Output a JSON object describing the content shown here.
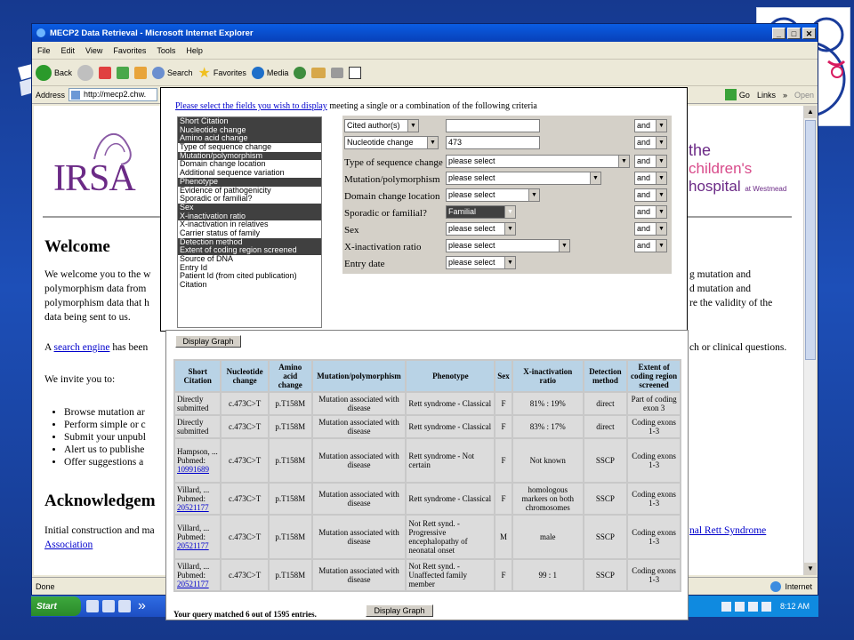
{
  "window": {
    "title": "MECP2 Data Retrieval - Microsoft Internet Explorer",
    "controls": [
      "_",
      "□",
      "✕"
    ],
    "menu": [
      "File",
      "Edit",
      "View",
      "Favorites",
      "Tools",
      "Help"
    ],
    "toolbar": {
      "back": "Back",
      "search": "Search",
      "favorites": "Favorites",
      "media": "Media"
    },
    "address_label": "Address",
    "address_value": "http://mecp2.chw.",
    "go": "Go",
    "links": "Links",
    "open": "Open",
    "status": "Done",
    "zone": "Internet"
  },
  "page": {
    "irsa": "IRSA",
    "chw": {
      "line1": "the",
      "line2": "children's",
      "line3": "hospital",
      "line3_small": "at Westmead"
    },
    "welcome_heading": "Welcome",
    "welcome_para_left": "We welcome you to the w",
    "welcome_para_left2": "polymorphism data from",
    "welcome_para_left3": "polymorphism data that h",
    "welcome_para_left4": "data being sent to us.",
    "welcome_para_right1": "g mutation and",
    "welcome_para_right2": "d mutation and",
    "welcome_para_right3": "re the validity of the",
    "search_prefix": "A ",
    "search_link": "search engine",
    "search_suffix": " has been",
    "search_right": "ch or clinical questions.",
    "invite": "We invite you to:",
    "bullets": [
      "Browse mutation ar",
      "Perform simple or c",
      "Submit your unpubl",
      "Alert us to publishe",
      "Offer suggestions a"
    ],
    "ack_heading": "Acknowledgem",
    "ack_text": "Initial construction and ma",
    "ack_link": "nal Rett Syndrome",
    "ack_link2": "Association"
  },
  "search": {
    "header_link": "Please select the fields you wish to display",
    "header_rest": " meeting a single or a combination of the following criteria",
    "fields": [
      {
        "label": "Short Citation",
        "selected": true
      },
      {
        "label": "Nucleotide change",
        "selected": true
      },
      {
        "label": "Amino acid change",
        "selected": true
      },
      {
        "label": "Type of sequence change",
        "selected": false
      },
      {
        "label": "Mutation/polymorphism",
        "selected": true
      },
      {
        "label": "Domain change location",
        "selected": false
      },
      {
        "label": "Additional sequence variation",
        "selected": false
      },
      {
        "label": "Phenotype",
        "selected": true
      },
      {
        "label": "Evidence of pathogenicity",
        "selected": false
      },
      {
        "label": "Sporadic or familial?",
        "selected": false
      },
      {
        "label": "Sex",
        "selected": true
      },
      {
        "label": "X-inactivation ratio",
        "selected": true
      },
      {
        "label": "X-inactivation in relatives",
        "selected": false
      },
      {
        "label": "Carrier status of family",
        "selected": false
      },
      {
        "label": "Detection method",
        "selected": true
      },
      {
        "label": "Extent of coding region screened",
        "selected": true
      },
      {
        "label": "Source of DNA",
        "selected": false
      },
      {
        "label": "Entry Id",
        "selected": false
      },
      {
        "label": "Patient Id (from cited publication)",
        "selected": false
      },
      {
        "label": "Citation",
        "selected": false
      }
    ],
    "criteria": {
      "row1_select": "Cited author(s)",
      "row2_select": "Nucleotide change",
      "row2_value": "473",
      "type_label": "Type of sequence change",
      "type_value": "please select",
      "mut_label": "Mutation/polymorphism",
      "mut_value": "please select",
      "domain_label": "Domain change location",
      "domain_value": "please select",
      "spor_label": "Sporadic or familial?",
      "spor_value": "Familial",
      "sex_label": "Sex",
      "sex_value": "please select",
      "xin_label": "X-inactivation ratio",
      "xin_value": "please select",
      "entry_label": "Entry date",
      "entry_value": "please select",
      "and": "and"
    }
  },
  "results": {
    "display_graph": "Display Graph",
    "headers": [
      "Short Citation",
      "Nucleotide change",
      "Amino acid change",
      "Mutation/polymorphism",
      "Phenotype",
      "Sex",
      "X-inactivation ratio",
      "Detection method",
      "Extent of coding region screened"
    ],
    "rows": [
      {
        "cite": "Directly submitted",
        "link": "",
        "nuc": "c.473C>T",
        "aa": "p.T158M",
        "mut": "Mutation associated with disease",
        "phen": "Rett syndrome - Classical",
        "sex": "F",
        "xin": "81% : 19%",
        "det": "direct",
        "ext": "Part of coding exon 3"
      },
      {
        "cite": "Directly submitted",
        "link": "",
        "nuc": "c.473C>T",
        "aa": "p.T158M",
        "mut": "Mutation associated with disease",
        "phen": "Rett syndrome - Classical",
        "sex": "F",
        "xin": "83% : 17%",
        "det": "direct",
        "ext": "Coding exons 1-3"
      },
      {
        "cite": "Hampson, ... Pubmed:",
        "link": "10991689",
        "nuc": "c.473C>T",
        "aa": "p.T158M",
        "mut": "Mutation associated with disease",
        "phen": "Rett syndrome - Not certain",
        "sex": "F",
        "xin": "Not known",
        "det": "SSCP",
        "ext": "Coding exons 1-3"
      },
      {
        "cite": "Villard, ... Pubmed:",
        "link": "20521177",
        "nuc": "c.473C>T",
        "aa": "p.T158M",
        "mut": "Mutation associated with disease",
        "phen": "Rett syndrome - Classical",
        "sex": "F",
        "xin": "homologous markers on both chromosomes",
        "det": "SSCP",
        "ext": "Coding exons 1-3"
      },
      {
        "cite": "Villard, ... Pubmed:",
        "link": "20521177",
        "nuc": "c.473C>T",
        "aa": "p.T158M",
        "mut": "Mutation associated with disease",
        "phen": "Not Rett synd. - Progressive encephalopathy of neonatal onset",
        "sex": "M",
        "xin": "male",
        "det": "SSCP",
        "ext": "Coding exons 1-3"
      },
      {
        "cite": "Villard, ... Pubmed:",
        "link": "20521177",
        "nuc": "c.473C>T",
        "aa": "p.T158M",
        "mut": "Mutation associated with disease",
        "phen": "Not Rett synd. - Unaffected family member",
        "sex": "F",
        "xin": "99 : 1",
        "det": "SSCP",
        "ext": "Coding exons 1-3"
      }
    ],
    "matched": "Your query matched 6 out of 1595 entries."
  },
  "taskbar": {
    "start": "Start",
    "chevron": "»",
    "time": "8:12 AM"
  }
}
